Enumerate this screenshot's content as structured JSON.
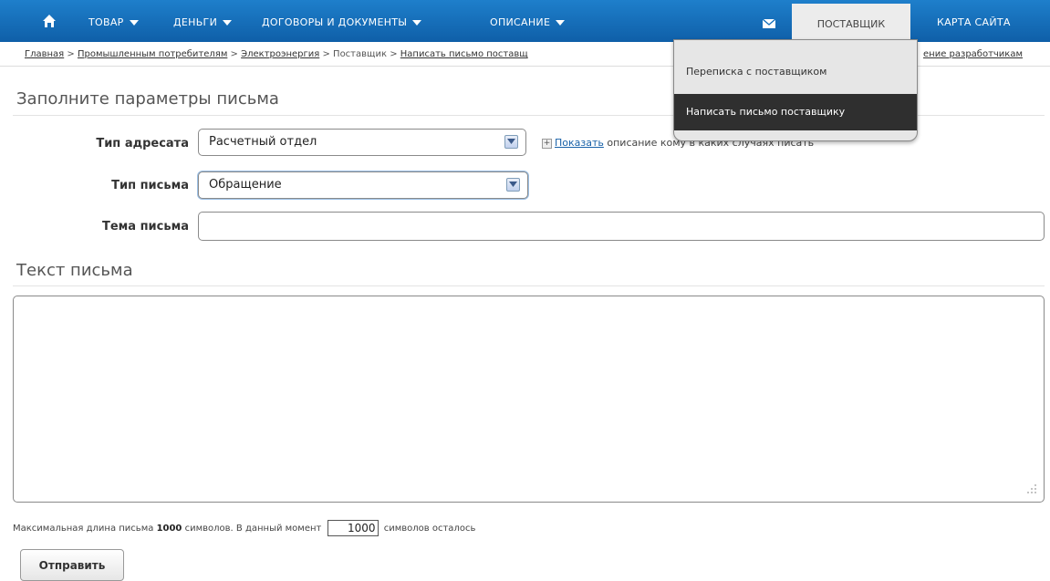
{
  "nav": {
    "items": [
      {
        "label": "ТОВАР"
      },
      {
        "label": "ДЕНЬГИ"
      },
      {
        "label": "ДОГОВОРЫ И ДОКУМЕНТЫ"
      },
      {
        "label": "ОПИСАНИЕ"
      }
    ],
    "active": "ПОСТАВЩИК",
    "sitemap": "КАРТА САЙТА",
    "icons": {
      "home": "home-icon",
      "mail": "mail-icon"
    },
    "colors": {
      "bar": "#1570bd",
      "active_bg": "#ececec"
    }
  },
  "breadcrumb": {
    "items": [
      "Главная",
      "Промышленным потребителям",
      "Электроэнергия"
    ],
    "current": "Поставщик",
    "last": "Написать письмо поставщ",
    "right": "ение разработчикам",
    "separator": ">"
  },
  "dropdown": {
    "items": [
      "Переписка с поставщиком",
      "Написать письмо поставщику"
    ],
    "selected": "Написать письмо поставщику"
  },
  "form": {
    "title": "Заполните параметры письма",
    "recipient": {
      "label": "Тип адресата",
      "value": "Расчетный отдел"
    },
    "letter_type": {
      "label": "Тип письма",
      "value": "Обращение"
    },
    "subject": {
      "label": "Тема письма",
      "value": ""
    },
    "show_link": "Показать",
    "show_text": "описание кому в каких случаях писать"
  },
  "body": {
    "title": "Текст письма",
    "value": ""
  },
  "limit": {
    "prefix": "Максимальная длина письма",
    "max": "1000",
    "middle": "символов. В данный момент",
    "remaining": "1000",
    "suffix": "символов осталось"
  },
  "submit": {
    "label": "Отправить"
  }
}
